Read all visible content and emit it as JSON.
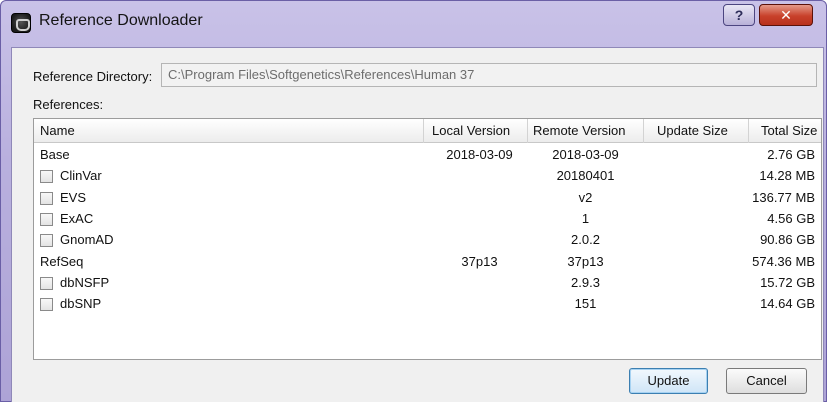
{
  "window": {
    "title": "Reference Downloader",
    "help_glyph": "?",
    "close_glyph": "✕",
    "icon": "app-icon"
  },
  "directory": {
    "label": "Reference Directory:",
    "value": "C:\\Program Files\\Softgenetics\\References\\Human 37"
  },
  "references_label": "References:",
  "table": {
    "columns": [
      "Name",
      "Local Version",
      "Remote Version",
      "Update Size",
      "Total Size"
    ],
    "rows": [
      {
        "name": "Base",
        "local": "2018-03-09",
        "remote": "2018-03-09",
        "update_size": "",
        "total_size": "2.76 GB",
        "checkbox": false
      },
      {
        "name": "ClinVar",
        "local": "",
        "remote": "20180401",
        "update_size": "",
        "total_size": "14.28 MB",
        "checkbox": true,
        "checked": false
      },
      {
        "name": "EVS",
        "local": "",
        "remote": "v2",
        "update_size": "",
        "total_size": "136.77 MB",
        "checkbox": true,
        "checked": false
      },
      {
        "name": "ExAC",
        "local": "",
        "remote": "1",
        "update_size": "",
        "total_size": "4.56 GB",
        "checkbox": true,
        "checked": false
      },
      {
        "name": "GnomAD",
        "local": "",
        "remote": "2.0.2",
        "update_size": "",
        "total_size": "90.86 GB",
        "checkbox": true,
        "checked": false
      },
      {
        "name": "RefSeq",
        "local": "37p13",
        "remote": "37p13",
        "update_size": "",
        "total_size": "574.36 MB",
        "checkbox": false
      },
      {
        "name": "dbNSFP",
        "local": "",
        "remote": "2.9.3",
        "update_size": "",
        "total_size": "15.72 GB",
        "checkbox": true,
        "checked": false
      },
      {
        "name": "dbSNP",
        "local": "",
        "remote": "151",
        "update_size": "",
        "total_size": "14.64 GB",
        "checkbox": true,
        "checked": false
      }
    ]
  },
  "buttons": {
    "update": "Update",
    "cancel": "Cancel"
  }
}
